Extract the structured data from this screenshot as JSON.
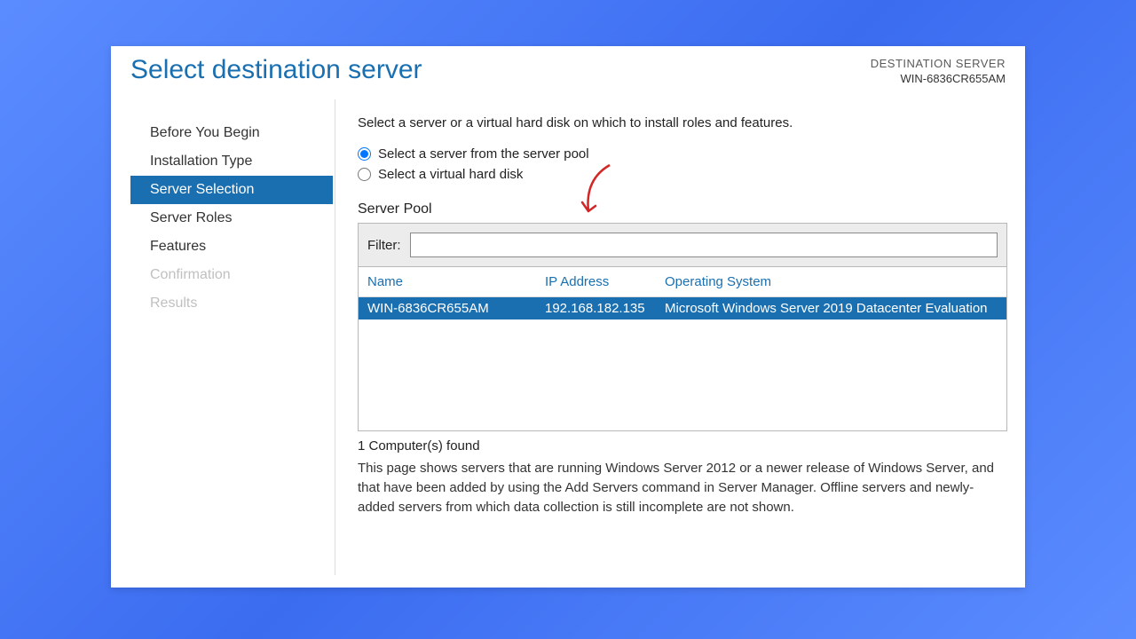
{
  "header": {
    "title": "Select destination server",
    "dest_label": "DESTINATION SERVER",
    "dest_name": "WIN-6836CR655AM"
  },
  "sidebar": {
    "items": [
      {
        "label": "Before You Begin",
        "state": "normal"
      },
      {
        "label": "Installation Type",
        "state": "normal"
      },
      {
        "label": "Server Selection",
        "state": "active"
      },
      {
        "label": "Server Roles",
        "state": "normal"
      },
      {
        "label": "Features",
        "state": "normal"
      },
      {
        "label": "Confirmation",
        "state": "disabled"
      },
      {
        "label": "Results",
        "state": "disabled"
      }
    ]
  },
  "main": {
    "instruction": "Select a server or a virtual hard disk on which to install roles and features.",
    "radio_pool": "Select a server from the server pool",
    "radio_vhd": "Select a virtual hard disk",
    "section_heading": "Server Pool",
    "filter_label": "Filter:",
    "filter_value": "",
    "columns": {
      "name": "Name",
      "ip": "IP Address",
      "os": "Operating System"
    },
    "rows": [
      {
        "name": "WIN-6836CR655AM",
        "ip": "192.168.182.135",
        "os": "Microsoft Windows Server 2019 Datacenter Evaluation"
      }
    ],
    "count_text": "1 Computer(s) found",
    "explain": "This page shows servers that are running Windows Server 2012 or a newer release of Windows Server, and that have been added by using the Add Servers command in Server Manager. Offline servers and newly-added servers from which data collection is still incomplete are not shown."
  },
  "annotation": {
    "arrow_color": "#d32626"
  }
}
